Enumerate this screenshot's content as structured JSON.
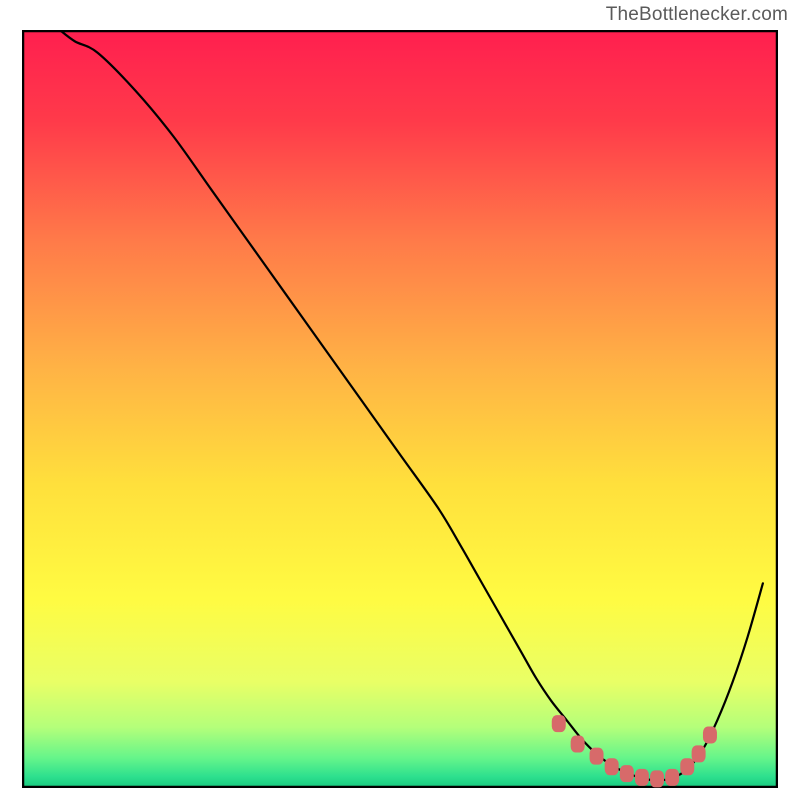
{
  "attribution": "TheBottlenecker.com",
  "chart_data": {
    "type": "line",
    "title": "",
    "xlabel": "",
    "ylabel": "",
    "xlim": [
      0,
      100
    ],
    "ylim": [
      0,
      100
    ],
    "grid": false,
    "background": "rainbow-gradient",
    "series": [
      {
        "name": "curve",
        "color": "#000000",
        "stroke_width": 2.2,
        "x": [
          5,
          7,
          10,
          15,
          20,
          25,
          30,
          35,
          40,
          45,
          50,
          55,
          58,
          60,
          62,
          64,
          66,
          68,
          70,
          72,
          74,
          76,
          78,
          80,
          82,
          84,
          86,
          88,
          90,
          92,
          94,
          96,
          98
        ],
        "y": [
          100,
          98.5,
          97,
          92,
          86,
          79,
          72,
          65,
          58,
          51,
          44,
          37,
          32,
          28.5,
          25,
          21.5,
          18,
          14.5,
          11.5,
          9,
          6.5,
          4.5,
          3,
          2,
          1.3,
          1,
          1.3,
          2.5,
          5,
          9,
          14,
          20,
          27
        ]
      },
      {
        "name": "highlight-markers",
        "color": "#d76a6a",
        "marker": "rounded-rect",
        "style": "markers-only",
        "x": [
          71,
          73.5,
          76,
          78,
          80,
          82,
          84,
          86,
          88,
          89.5,
          91
        ],
        "y": [
          8.5,
          5.8,
          4.2,
          2.8,
          1.9,
          1.4,
          1.2,
          1.4,
          2.8,
          4.5,
          7.0
        ]
      }
    ],
    "gradient_stops": [
      {
        "offset": 0.0,
        "color": "#ff1f4f"
      },
      {
        "offset": 0.12,
        "color": "#ff3a4a"
      },
      {
        "offset": 0.28,
        "color": "#ff7b49"
      },
      {
        "offset": 0.45,
        "color": "#ffb445"
      },
      {
        "offset": 0.6,
        "color": "#ffe03c"
      },
      {
        "offset": 0.75,
        "color": "#fffb42"
      },
      {
        "offset": 0.86,
        "color": "#e9ff66"
      },
      {
        "offset": 0.92,
        "color": "#b4ff7a"
      },
      {
        "offset": 0.96,
        "color": "#66f58a"
      },
      {
        "offset": 0.985,
        "color": "#2de08e"
      },
      {
        "offset": 1.0,
        "color": "#18c97f"
      }
    ]
  }
}
